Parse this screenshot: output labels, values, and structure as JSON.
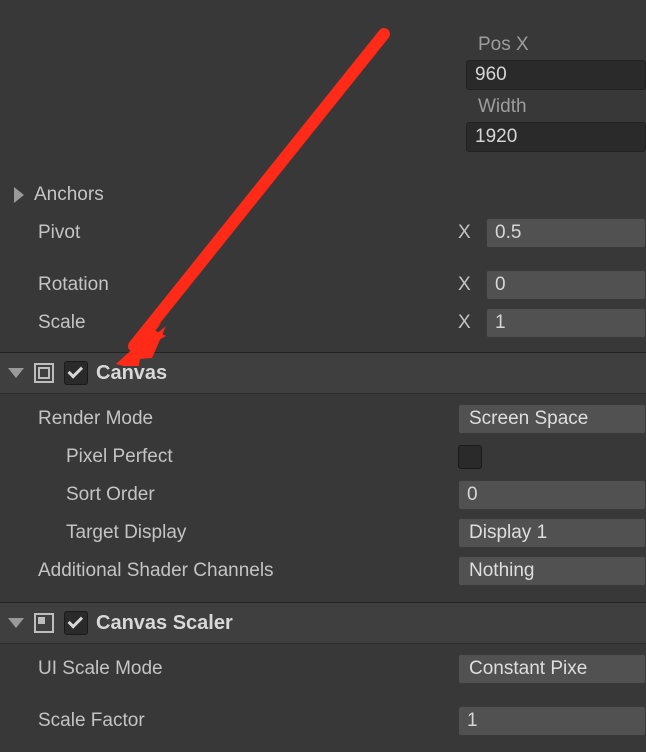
{
  "rect": {
    "pos_x_label": "Pos X",
    "pos_x_value": "960",
    "width_label": "Width",
    "width_value": "1920",
    "anchors_label": "Anchors",
    "pivot_label": "Pivot",
    "pivot_x_label": "X",
    "pivot_x_value": "0.5",
    "rotation_label": "Rotation",
    "rotation_x_label": "X",
    "rotation_x_value": "0",
    "scale_label": "Scale",
    "scale_x_label": "X",
    "scale_x_value": "1"
  },
  "canvas": {
    "title": "Canvas",
    "enabled": true,
    "render_mode_label": "Render Mode",
    "render_mode_value": "Screen Space",
    "pixel_perfect_label": "Pixel Perfect",
    "pixel_perfect_value": false,
    "sort_order_label": "Sort Order",
    "sort_order_value": "0",
    "target_display_label": "Target Display",
    "target_display_value": "Display 1",
    "additional_channels_label": "Additional Shader Channels",
    "additional_channels_value": "Nothing"
  },
  "canvas_scaler": {
    "title": "Canvas Scaler",
    "enabled": true,
    "ui_scale_mode_label": "UI Scale Mode",
    "ui_scale_mode_value": "Constant Pixe",
    "scale_factor_label": "Scale Factor",
    "scale_factor_value": "1"
  }
}
